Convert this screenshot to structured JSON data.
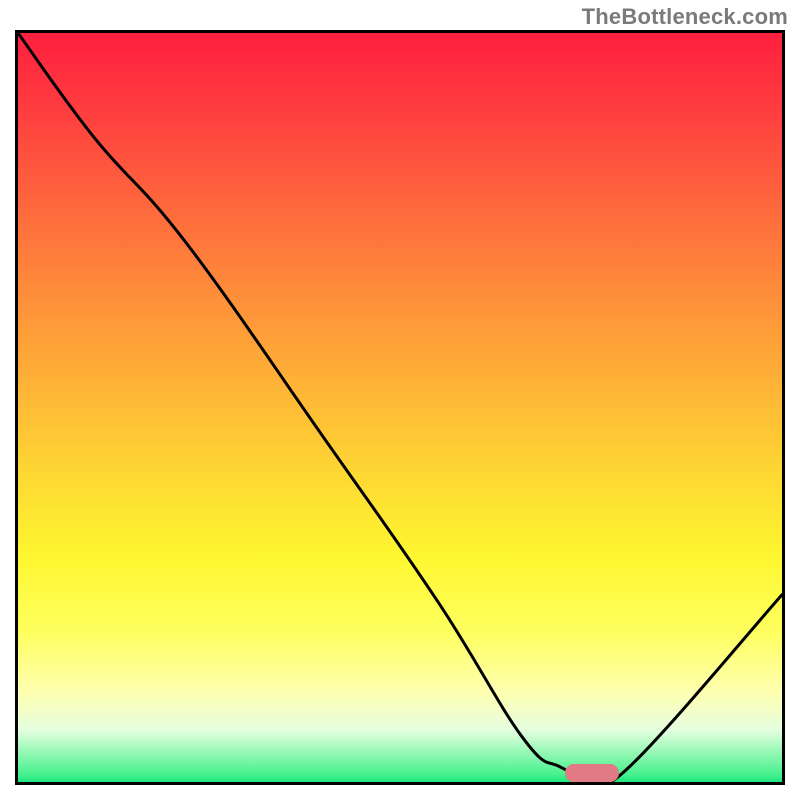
{
  "watermark": "TheBottleneck.com",
  "chart_data": {
    "type": "line",
    "title": "",
    "xlabel": "",
    "ylabel": "",
    "xlim": [
      0,
      100
    ],
    "ylim": [
      0,
      100
    ],
    "grid": false,
    "legend": false,
    "background": "red-yellow-green vertical gradient (high=red, mid=yellow, low=green)",
    "series": [
      {
        "name": "bottleneck-curve",
        "color": "#000000",
        "x": [
          0,
          10,
          22,
          40,
          55,
          66,
          71,
          75,
          80,
          100
        ],
        "y": [
          100,
          86,
          72,
          46,
          24,
          6,
          2,
          1,
          2,
          25
        ]
      }
    ],
    "marker": {
      "name": "optimal-region",
      "color": "#e17a85",
      "x_range": [
        71,
        78
      ],
      "y": 2
    }
  },
  "colors": {
    "curve": "#000000",
    "marker": "#e17a85",
    "frame": "#000000",
    "watermark": "#7a7a7a"
  }
}
